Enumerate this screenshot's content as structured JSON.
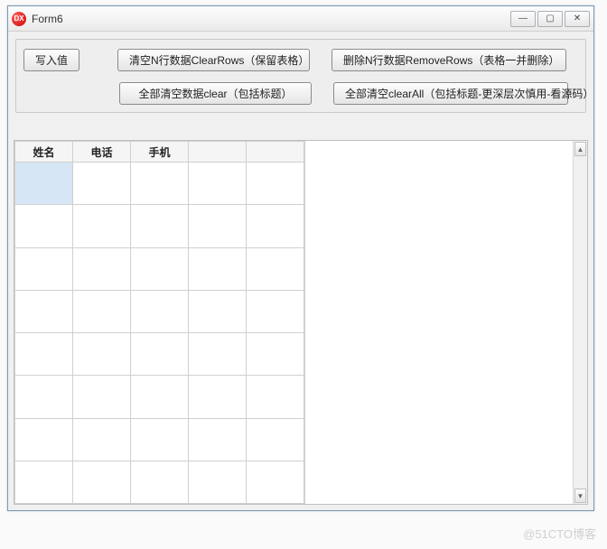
{
  "window": {
    "title": "Form6",
    "icon_text": "DX"
  },
  "toolbar": {
    "write_label": "写入值",
    "clearrows_label": "清空N行数据ClearRows（保留表格）",
    "removerows_label": "删除N行数据RemoveRows（表格一并删除）",
    "clear_label": "全部清空数据clear（包括标题）",
    "clearall_label": "全部清空clearAll（包括标题-更深层次慎用-看源码）"
  },
  "grid": {
    "columns": [
      "姓名",
      "电话",
      "手机",
      "",
      ""
    ],
    "rows": [
      [
        "",
        "",
        "",
        "",
        ""
      ],
      [
        "",
        "",
        "",
        "",
        ""
      ],
      [
        "",
        "",
        "",
        "",
        ""
      ],
      [
        "",
        "",
        "",
        "",
        ""
      ],
      [
        "",
        "",
        "",
        "",
        ""
      ],
      [
        "",
        "",
        "",
        "",
        ""
      ],
      [
        "",
        "",
        "",
        "",
        ""
      ],
      [
        "",
        "",
        "",
        "",
        ""
      ]
    ],
    "selected": {
      "row": 0,
      "col": 0
    }
  },
  "watermark": "@51CTO博客"
}
